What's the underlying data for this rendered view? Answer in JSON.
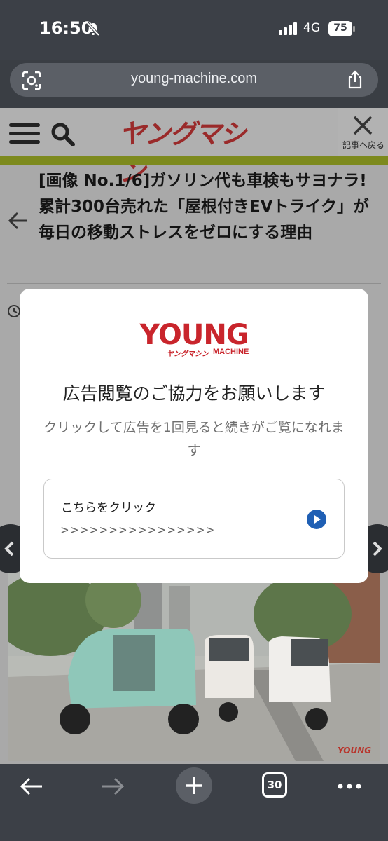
{
  "status_bar": {
    "time": "16:50",
    "network": "4G",
    "battery": "75"
  },
  "browser": {
    "url": "young-machine.com",
    "tab_count": "30"
  },
  "site": {
    "logo_text": "ヤングマシン",
    "back_to_article": "記事へ戻る",
    "headline": "[画像 No.1/6]ガソリン代も車検もサヨナラ! 累計300台売れた「屋根付きEVトライク」が毎日の移動ストレスをゼロにする理由"
  },
  "photo": {
    "credit": "YOUNG"
  },
  "modal": {
    "logo_main": "YOUNG",
    "logo_sub_kana": "ヤングマシン",
    "logo_sub_en": "MACHINE",
    "title": "広告閲覧のご協力をお願いします",
    "description": "クリックして広告を1回見ると続きがご覧になれます",
    "cta_label": "こちらをクリック",
    "cta_arrows": ">>>>>>>>>>>>>>>>"
  },
  "colors": {
    "brand_red": "#c9252c",
    "accent_blue": "#1f5fb4",
    "green_strip": "#7d8a1e"
  }
}
